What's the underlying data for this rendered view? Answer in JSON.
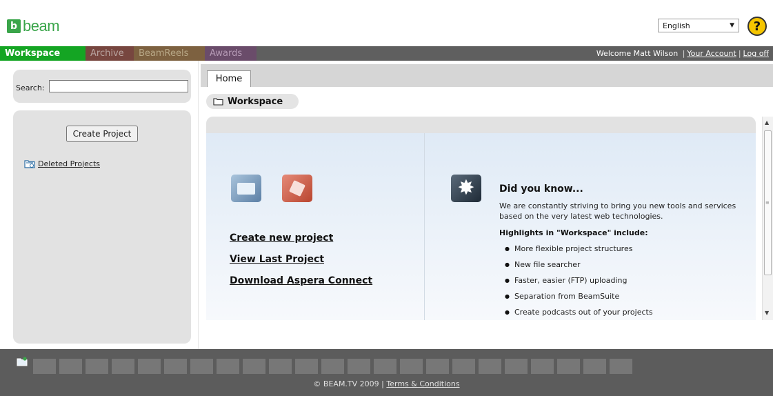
{
  "header": {
    "logo_text": "beam",
    "logo_mark": "b",
    "language": "English",
    "help_icon": "help-question-icon"
  },
  "nav": {
    "tabs": [
      {
        "label": "Workspace",
        "color": "#14a523",
        "active": true
      },
      {
        "label": "Archive",
        "color": "#77463f"
      },
      {
        "label": "BeamReels",
        "color": "#7d6140"
      },
      {
        "label": "Awards",
        "color": "#6a4c6a"
      }
    ],
    "welcome": "Welcome",
    "user_name": "Matt Wilson",
    "account_link": "Your Account",
    "logoff_link": "Log off",
    "separator": "|"
  },
  "sidebar": {
    "search_label": "Search:",
    "search_value": "",
    "create_button": "Create Project",
    "deleted_link": "Deleted Projects"
  },
  "main": {
    "tab_home": "Home",
    "breadcrumb": "Workspace",
    "actions": [
      "Create new project",
      "View Last Project",
      "Download Aspera Connect"
    ],
    "dyk_title": "Did you know...",
    "dyk_text": "We are constantly striving to bring you new tools and services based on the very latest web technologies.",
    "highlights_heading": "Highlights in \"Workspace\" include:",
    "highlights": [
      "More flexible project structures",
      "New file searcher",
      "Faster, easier (FTP) uploading",
      "Separation from BeamSuite",
      "Create podcasts out of your projects"
    ]
  },
  "footer": {
    "copyright": "© BEAM.TV 2009",
    "separator": "|",
    "terms": "Terms & Conditions"
  }
}
